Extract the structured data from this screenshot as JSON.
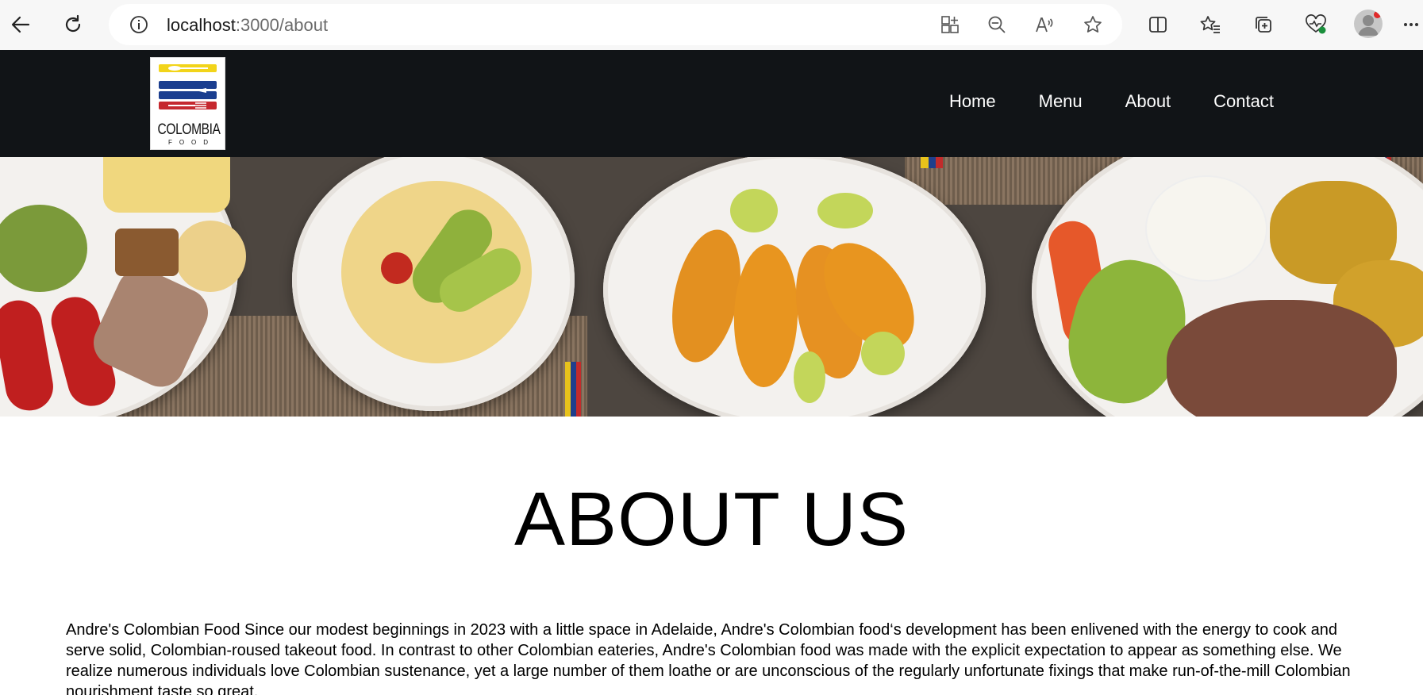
{
  "browser": {
    "url_host": "localhost",
    "url_path": ":3000/about",
    "icons": [
      "back-icon",
      "reload-icon",
      "site-info-icon",
      "apps-icon",
      "zoom-out-icon",
      "read-aloud-icon",
      "favorite-star-icon",
      "split-screen-icon",
      "favorites-icon",
      "collections-icon",
      "browser-essentials-icon",
      "profile-avatar",
      "more-options-icon"
    ]
  },
  "header": {
    "logo_text": "COLOMBIA",
    "logo_subtext": "FOOD",
    "logo_colors": [
      "#f2d41a",
      "#1b3e8f",
      "#c5282e"
    ],
    "nav": [
      {
        "label": "Home"
      },
      {
        "label": "Menu"
      },
      {
        "label": "About"
      },
      {
        "label": "Contact"
      }
    ]
  },
  "hero": {
    "image_name": "colombian-food-banner"
  },
  "main": {
    "title": "ABOUT US",
    "paragraph": "Andre's Colombian Food Since our modest beginnings in 2023 with a little space in Adelaide, Andre's Colombian food‘s development has been enlivened with the energy to cook and serve solid, Colombian-roused takeout food. In contrast to other Colombian eateries, Andre's Colombian food was made with the explicit expectation to appear as something else. We realize numerous individuals love Colombian sustenance, yet a large number of them loathe or are unconscious of the regularly unfortunate fixings that make run-of-the-mill Colombian nourishment taste so great."
  }
}
